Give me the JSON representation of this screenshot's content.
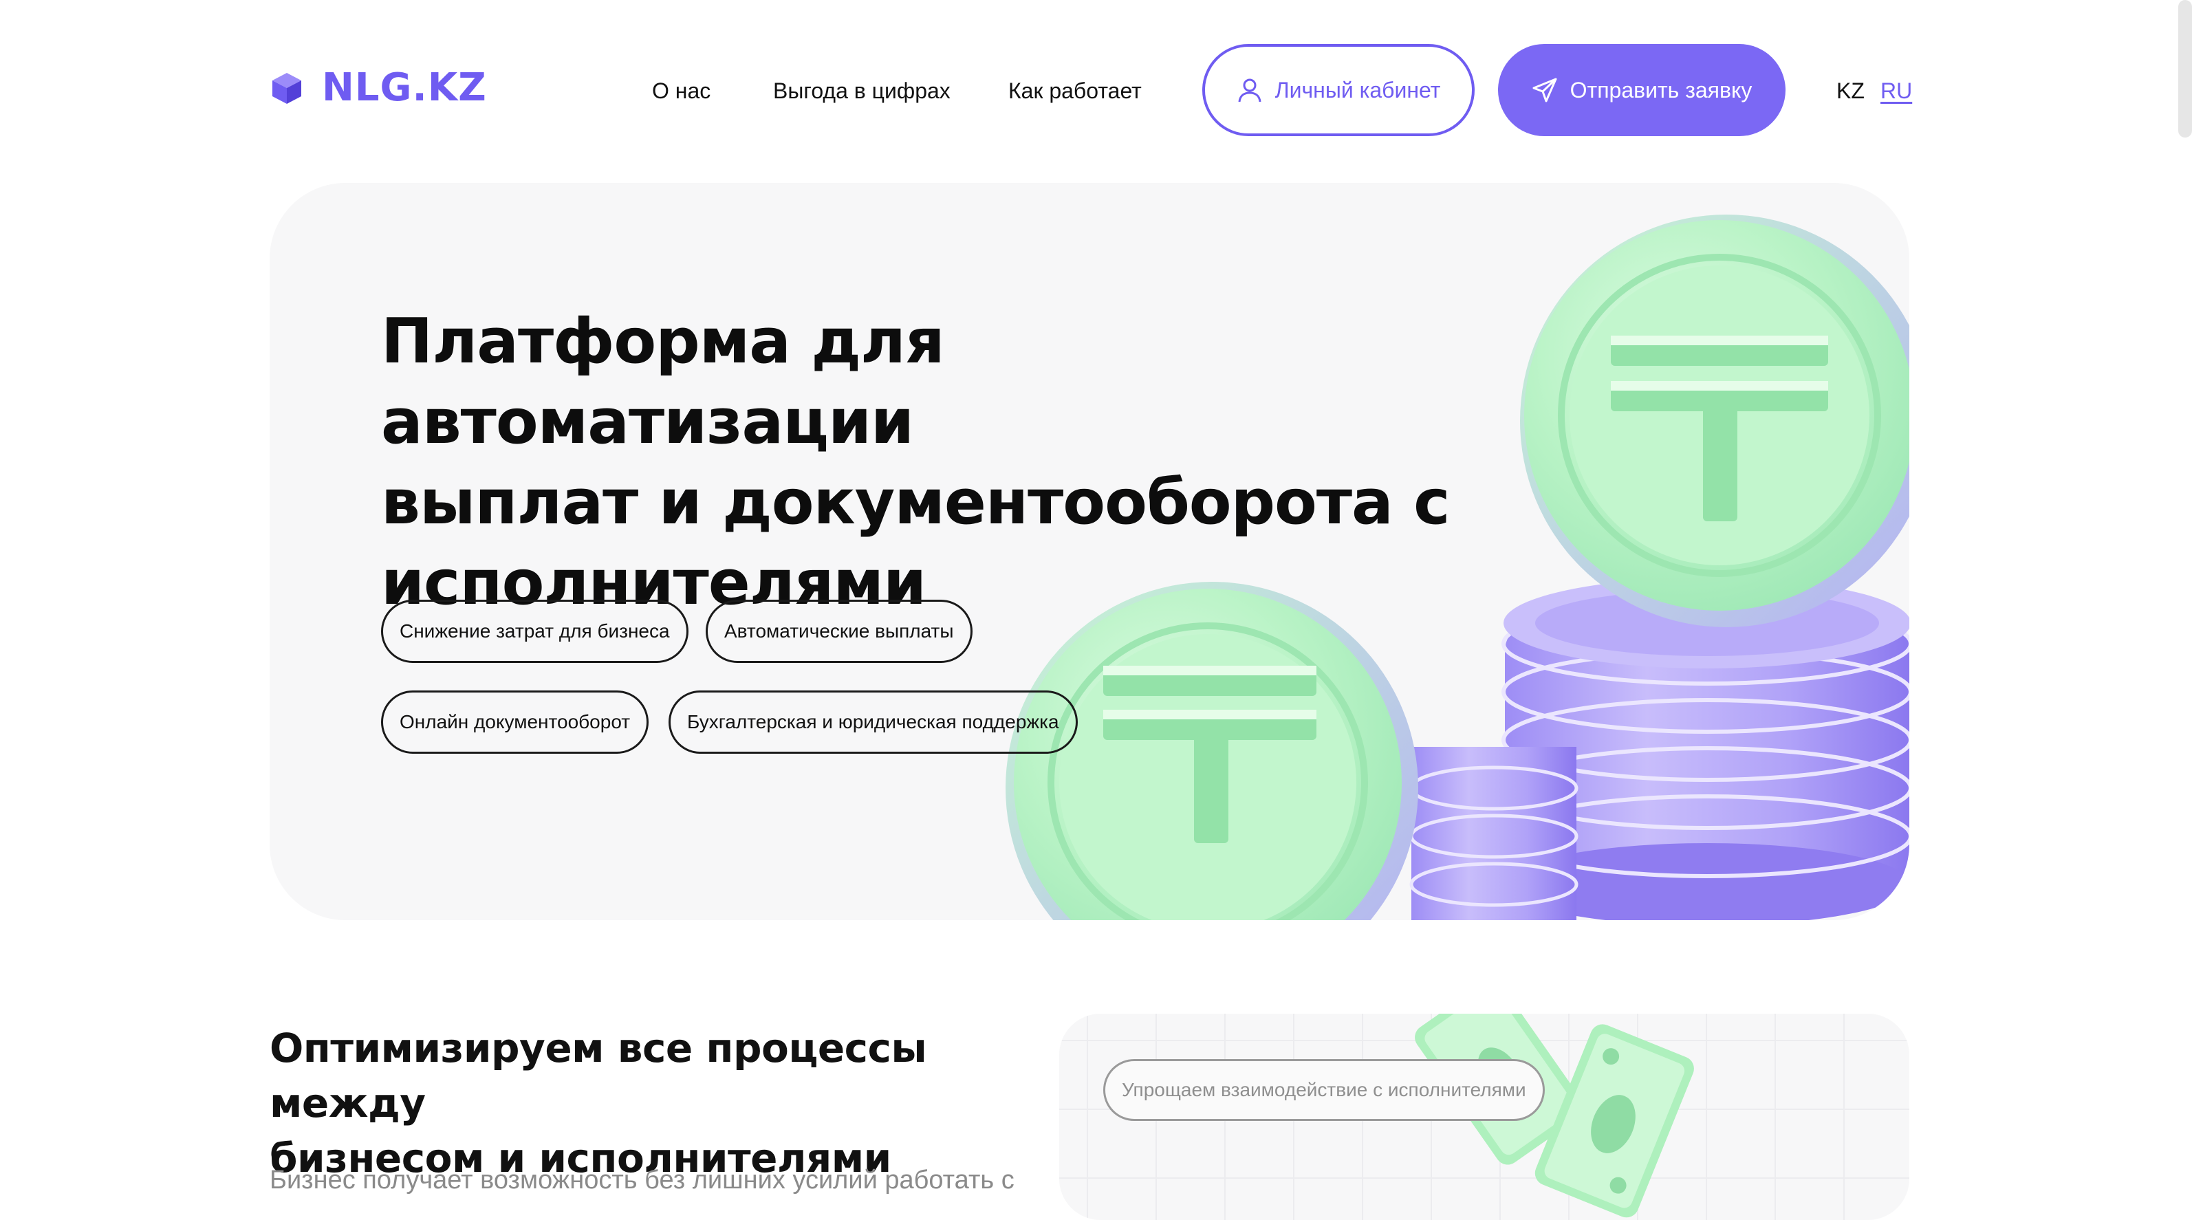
{
  "header": {
    "logo_text": "NLG.KZ",
    "nav": [
      "О нас",
      "Выгода в цифрах",
      "Как работает"
    ],
    "cabinet_label": "Личный кабинет",
    "send_label": "Отправить заявку",
    "lang_kz": "KZ",
    "lang_ru": "RU",
    "active_lang": "RU"
  },
  "hero": {
    "title_lines": [
      "Платформа для автоматизации",
      "выплат и документооборота с",
      "исполнителями"
    ],
    "features": [
      "Снижение затрат для бизнеса",
      "Автоматические выплаты",
      "Онлайн документооборот",
      "Бухгалтерская и юридическая поддержка"
    ]
  },
  "section": {
    "title_lines": [
      "Оптимизируем все процессы между",
      "бизнесом и исполнителями"
    ],
    "text": "Бизнес получает возможность без лишних усилий работать с",
    "panel_pill": "Упрощаем взаимодействие с исполнителями"
  },
  "colors": {
    "accent": "#6f5cf1",
    "button_fill": "#7b68f4",
    "hero_bg": "#f7f7f8",
    "coin_green": "#b8f5c4",
    "coin_purple": "#a897f7"
  },
  "icons": {
    "logo": "cube-icon",
    "cabinet": "user-icon",
    "send": "paper-plane-icon"
  }
}
